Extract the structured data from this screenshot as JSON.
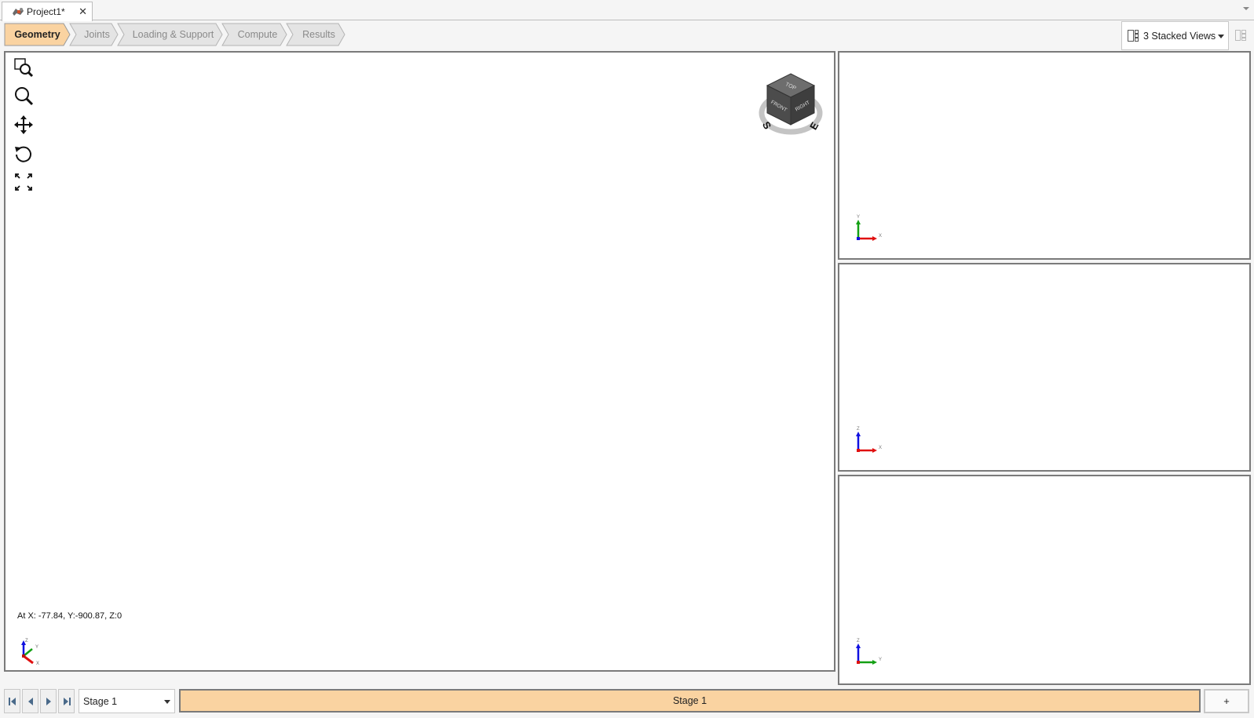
{
  "document_tab": {
    "title": "Project1*",
    "icon": "project-icon",
    "close_icon": "close-icon"
  },
  "workflow": {
    "steps": [
      {
        "label": "Geometry",
        "active": true
      },
      {
        "label": "Joints",
        "active": false
      },
      {
        "label": "Loading & Support",
        "active": false
      },
      {
        "label": "Compute",
        "active": false
      },
      {
        "label": "Results",
        "active": false
      }
    ],
    "active_color": "#fad3a1",
    "inactive_color": "#e4e4e4"
  },
  "view_layout": {
    "selected": "3 Stacked Views",
    "icon": "stacked-views-icon",
    "layout_button_icon": "layout-toggle-icon"
  },
  "main_view": {
    "tools": [
      {
        "name": "zoom-window-icon"
      },
      {
        "name": "zoom-icon"
      },
      {
        "name": "pan-icon"
      },
      {
        "name": "rotate-icon"
      },
      {
        "name": "zoom-extents-icon"
      }
    ],
    "coordinate_readout": "At X: -77.84, Y:-900.87, Z:0",
    "navcube": {
      "top": "TOP",
      "front": "FRONT",
      "right": "RIGHT",
      "compass_s": "S",
      "compass_e": "E"
    },
    "triad": {
      "x": "X",
      "y": "Y",
      "z": "Z"
    }
  },
  "side_views": [
    {
      "triad_axes": [
        "X",
        "Y",
        "Z"
      ],
      "up": "Y",
      "right": "X"
    },
    {
      "triad_axes": [
        "X",
        "Z",
        "Y"
      ],
      "up": "Z",
      "right": "X"
    },
    {
      "triad_axes": [
        "Y",
        "Z",
        "X"
      ],
      "up": "Z",
      "right": "Y"
    }
  ],
  "stage_bar": {
    "nav_buttons": [
      "first-stage-icon",
      "previous-stage-icon",
      "next-stage-icon",
      "last-stage-icon"
    ],
    "selected_stage": "Stage 1",
    "current_stage_label": "Stage 1",
    "add_label": "+"
  },
  "colors": {
    "axis_x": "#e01010",
    "axis_y": "#14a014",
    "axis_z": "#1010e0",
    "stage_fill": "#fad3a1"
  }
}
